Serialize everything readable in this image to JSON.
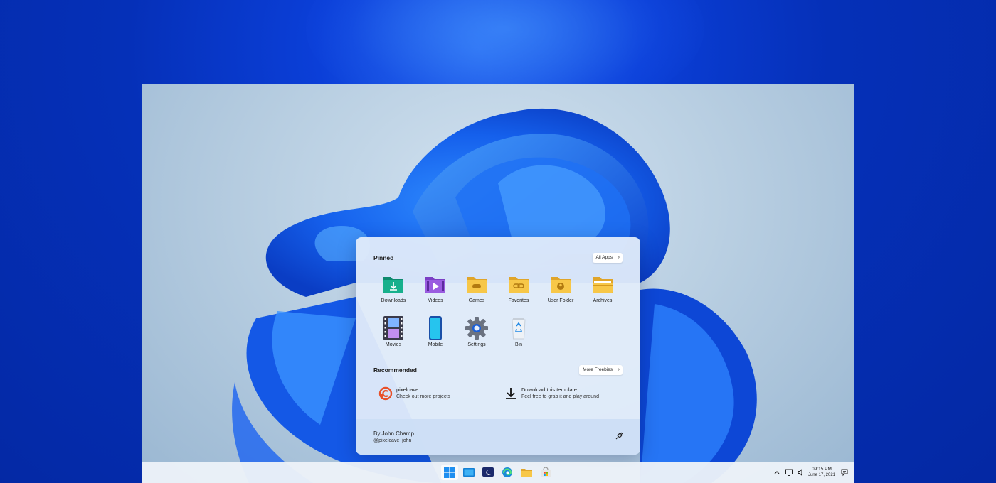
{
  "start_menu": {
    "pinned_title": "Pinned",
    "all_apps_label": "All Apps",
    "pinned": [
      {
        "label": "Downloads",
        "icon": "downloads-folder-icon"
      },
      {
        "label": "Videos",
        "icon": "videos-folder-icon"
      },
      {
        "label": "Games",
        "icon": "games-folder-icon"
      },
      {
        "label": "Favorites",
        "icon": "favorites-folder-icon"
      },
      {
        "label": "User Folder",
        "icon": "user-folder-icon"
      },
      {
        "label": "Archives",
        "icon": "archives-folder-icon"
      },
      {
        "label": "Movies",
        "icon": "film-strip-icon"
      },
      {
        "label": "Mobile",
        "icon": "mobile-phone-icon"
      },
      {
        "label": "Settings",
        "icon": "gear-icon"
      },
      {
        "label": "Bin",
        "icon": "recycle-bin-icon"
      }
    ],
    "recommended_title": "Recommended",
    "more_freebies_label": "More Freebies",
    "recommended": [
      {
        "title": "pixelcave",
        "subtitle": "Check out more projects",
        "icon": "pixelcave-logo-icon"
      },
      {
        "title": "Download this template",
        "subtitle": "Feel free to grab it and play around",
        "icon": "download-icon"
      }
    ],
    "user": {
      "name": "By John Champ",
      "handle": "@pixelcave_john"
    }
  },
  "taskbar": {
    "apps": [
      "start-icon",
      "desktop-icon",
      "weather-icon",
      "edge-icon",
      "file-explorer-icon",
      "store-icon"
    ],
    "tray": [
      "chevron-up-icon",
      "monitor-icon",
      "speaker-icon",
      "notification-icon"
    ],
    "time": "09:15 PM",
    "date": "June 17, 2021"
  },
  "colors": {
    "background": "#0530b8",
    "accent": "#1f6fe0",
    "panel": "#e2ecfa"
  }
}
